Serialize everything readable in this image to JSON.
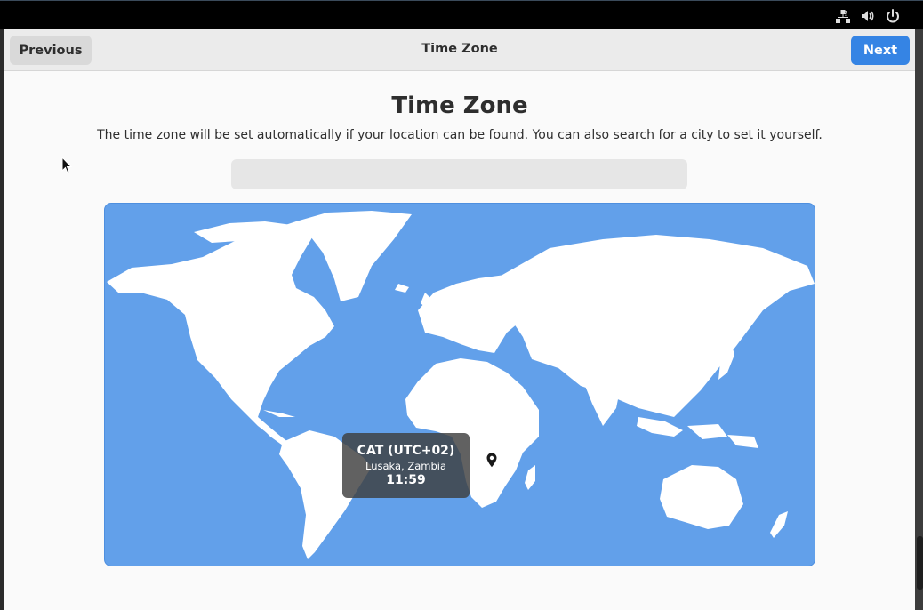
{
  "system_tray": {
    "icons": [
      "network-offline-icon",
      "volume-icon",
      "power-icon"
    ]
  },
  "header": {
    "title": "Time Zone",
    "previous_label": "Previous",
    "next_label": "Next"
  },
  "page": {
    "heading": "Time Zone",
    "description": "The time zone will be set automatically if your location can be found. You can also search for a city to set it yourself.",
    "search_value": "",
    "search_placeholder": ""
  },
  "timezone": {
    "abbreviation": "CAT (UTC+02)",
    "location": "Lusaka, Zambia",
    "time": "11:59"
  },
  "colors": {
    "accent": "#3584e4",
    "map_ocean": "#62a0ea",
    "map_land": "#ffffff"
  }
}
